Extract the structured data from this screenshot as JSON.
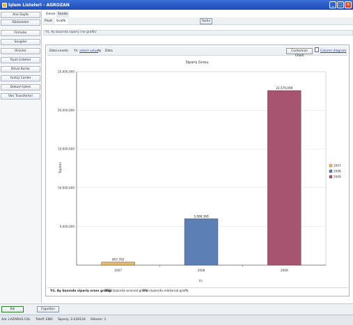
{
  "window": {
    "title": "İşlem Listeleri - AGROZAN"
  },
  "sidebar": {
    "items": [
      {
        "label": "Ana Sayfa"
      },
      {
        "label": "Yüklemeler"
      },
      {
        "label": "Firmalar"
      },
      {
        "label": "Sevgiler"
      },
      {
        "label": "Ürünler"
      },
      {
        "label": "Fiyat Listeleri"
      },
      {
        "label": "Döviz Kurlar"
      },
      {
        "label": "Yurtiçi Cariler"
      },
      {
        "label": "Dokum İşlem"
      },
      {
        "label": "Veri Transferleri"
      }
    ]
  },
  "tabs": {
    "top": [
      "Genel",
      "Sonda"
    ],
    "sub": [
      "Pivot",
      "Grafik"
    ]
  },
  "toolbar": {
    "print_label": "Yazdır"
  },
  "breadcrumb": "Yıl, Ay bazında sipariş (no grafik)",
  "controls": {
    "data_levels_label": "Data Levels:",
    "year_label": "Yıl",
    "select_value_link": "select value",
    "month_label": "Ay",
    "data_label": "Data",
    "customize_label": "Customize Chart",
    "diagram_label": "Column diagram"
  },
  "chart_data": {
    "type": "bar",
    "title": "Sipariş Grosu",
    "xlabel": "Yıl",
    "ylabel": "Toplam",
    "categories": [
      "2007",
      "2008",
      "2009"
    ],
    "values": [
      407702,
      5996360,
      22570099
    ],
    "value_labels": [
      "407,702",
      "5,996,360",
      "22,570,099"
    ],
    "colors": [
      "#e8b96a",
      "#5c7fb5",
      "#a6546f"
    ],
    "ylim": [
      0,
      25000000
    ],
    "yticks": [
      5000000,
      10000000,
      15000000,
      20000000,
      25000000
    ],
    "ytick_labels": [
      "5,000,000",
      "10,000,000",
      "15,000,000",
      "20,000,000",
      "25,000,000"
    ],
    "legend": [
      "2007",
      "2008",
      "2009"
    ],
    "legend_position": "right"
  },
  "bottom_tabs": [
    "Yıl, Ay bazında sipariş oranı grafiği",
    "Ürün bazında oransal grafik",
    "Ürün bazında miktarsal grafik"
  ],
  "footer": {
    "ok_label": "Kik",
    "options_label": "Fişpolları"
  },
  "status": {
    "user": "Adı: LAZARUS.COL",
    "phone": "Telefİ: ENO",
    "order": "Sipariş: 2-230124",
    "period": "Dönem: 1"
  }
}
